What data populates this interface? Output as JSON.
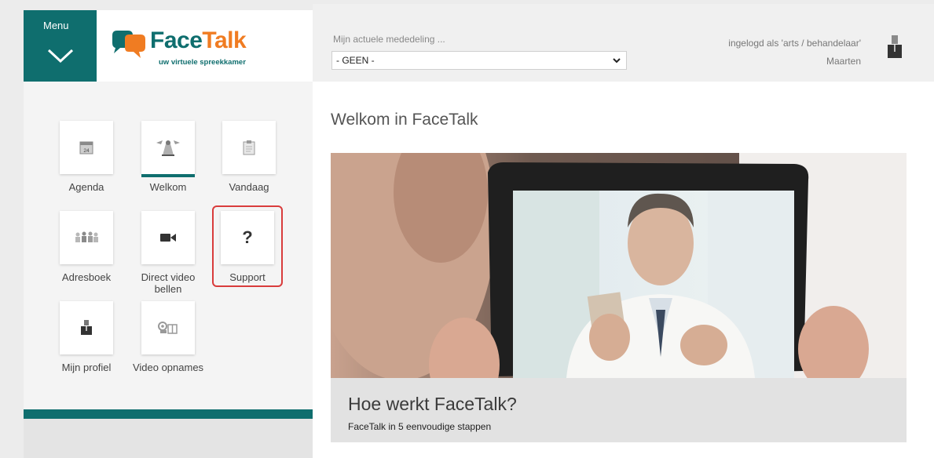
{
  "menu": {
    "label": "Menu"
  },
  "logo": {
    "name_part1": "Face",
    "name_part2": "Talk",
    "tagline": "uw virtuele spreekkamer"
  },
  "tiles": [
    {
      "label": "Agenda",
      "icon": "calendar-icon",
      "badge": "24"
    },
    {
      "label": "Welkom",
      "icon": "welcome-icon",
      "active": true
    },
    {
      "label": "Vandaag",
      "icon": "clipboard-icon"
    },
    {
      "label": "Adresboek",
      "icon": "contacts-icon"
    },
    {
      "label": "Direct video bellen",
      "icon": "video-camera-icon"
    },
    {
      "label": "Support",
      "icon": "question-mark-icon",
      "glyph": "?"
    },
    {
      "label": "Mijn profiel",
      "icon": "profile-icon"
    },
    {
      "label": "Video opnames",
      "icon": "video-recording-icon"
    }
  ],
  "topbar": {
    "notice_label": "Mijn actuele mededeling ...",
    "notice_value": "- GEEN -",
    "login_text": "ingelogd als 'arts / behandelaar'",
    "user_name": "Maarten"
  },
  "main": {
    "welcome_title": "Welkom in FaceTalk",
    "card_title": "Hoe werkt FaceTalk?",
    "card_subtitle": "FaceTalk in 5 eenvoudige stappen"
  },
  "colors": {
    "brand_teal": "#0f6e6e",
    "brand_orange": "#f07c22",
    "highlight_red": "#d93c3c"
  }
}
